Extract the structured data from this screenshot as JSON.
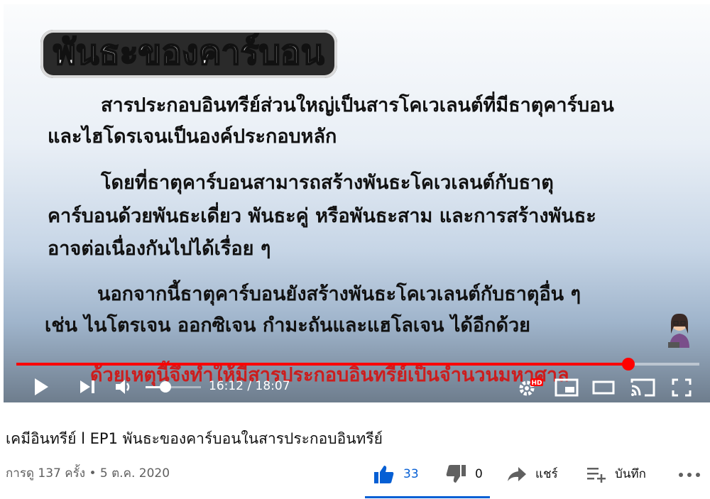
{
  "slide": {
    "title": "พันธะของคาร์บอน",
    "para1_line1": "สารประกอบอินทรีย์ส่วนใหญ่เป็นสารโคเวเลนต์ที่มีธาตุคาร์บอน",
    "para1_line2": "และไฮโดรเจนเป็นองค์ประกอบหลัก",
    "para2_line1": "โดยที่ธาตุคาร์บอนสามารถสร้างพันธะโคเวเลนต์กับธาตุ",
    "para2_line2": "คาร์บอนด้วยพันธะเดี่ยว พันธะคู่ หรือพันธะสาม และการสร้างพันธะ",
    "para2_line3": "อาจต่อเนื่องกันไปได้เรื่อย ๆ",
    "para3_line1": "นอกจากนี้ธาตุคาร์บอนยังสร้างพันธะโคเวเลนต์กับธาตุอื่น ๆ",
    "para3_line2": "เช่น ไนโตรเจน ออกซิเจน กำมะถันและแฮโลเจน ได้อีกด้วย",
    "para4_partial": "ด้วยเหตุนี้จึงทำให้มีสารประกอบอินทรีย์เป็นจำนวนมหาศาล"
  },
  "player": {
    "progress": 0.896,
    "volume": 0.36,
    "time_display": "16:12 / 18:07",
    "hd_badge": "HD",
    "accent": "#ff0000",
    "icons": [
      "play-icon",
      "next-icon",
      "volume-icon",
      "settings-icon",
      "miniplayer-icon",
      "theater-icon",
      "cast-icon",
      "fullscreen-icon"
    ]
  },
  "video": {
    "title": "เคมีอินทรีย์ l EP1 พันธะของคาร์บอนในสารประกอบอินทรีย์",
    "views_date": "การดู 137 ครั้ง • 5 ต.ค. 2020"
  },
  "actions": {
    "likes": "33",
    "dislikes": "0",
    "share": "แชร์",
    "save": "บันทึก",
    "like_color": "#065fd4"
  }
}
